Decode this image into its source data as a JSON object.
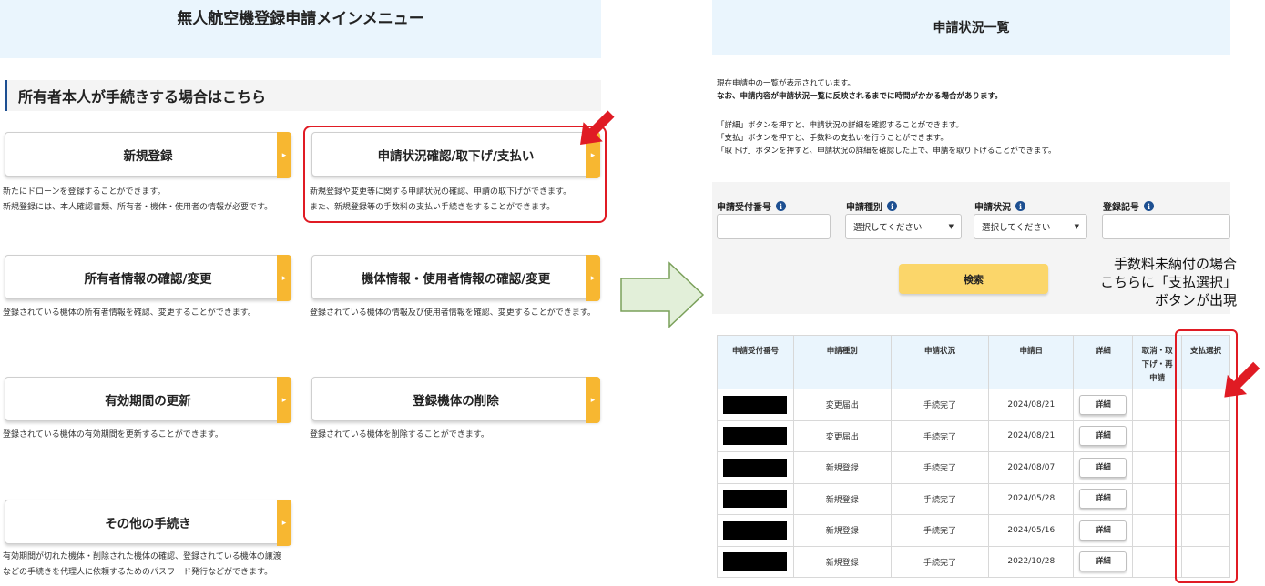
{
  "left": {
    "title": "無人航空機登録申請メインメニュー",
    "section_heading": "所有者本人が手続きする場合はこちら",
    "items": [
      {
        "label": "新規登録",
        "desc1": "新たにドローンを登録することができます。",
        "desc2": "新規登録には、本人確認書類、所有者・機体・使用者の情報が必要です。"
      },
      {
        "label": "申請状況確認/取下げ/支払い",
        "desc1": "新規登録や変更等に関する申請状況の確認、申請の取下げができます。",
        "desc2": "また、新規登録等の手数料の支払い手続きをすることができます。"
      },
      {
        "label": "所有者情報の確認/変更",
        "desc1": "登録されている機体の所有者情報を確認、変更することができます。"
      },
      {
        "label": "機体情報・使用者情報の確認/変更",
        "desc1": "登録されている機体の情報及び使用者情報を確認、変更することができます。"
      },
      {
        "label": "有効期間の更新",
        "desc1": "登録されている機体の有効期間を更新することができます。"
      },
      {
        "label": "登録機体の削除",
        "desc1": "登録されている機体を削除することができます。"
      },
      {
        "label": "その他の手続き",
        "desc1": "有効期間が切れた機体・削除された機体の確認、登録されている機体の譲渡",
        "desc2": "などの手続きを代理人に依頼するためのパスワード発行などができます。"
      }
    ],
    "arrow_symbol": "▸"
  },
  "right": {
    "title": "申請状況一覧",
    "info_lines": [
      "現在申請中の一覧が表示されています。",
      "なお、申請内容が申請状況一覧に反映されるまでに時間がかかる場合があります。",
      "「詳細」ボタンを押すと、申請状況の詳細を確認することができます。",
      "「支払」ボタンを押すと、手数料の支払いを行うことができます。",
      "「取下げ」ボタンを押すと、申請状況の詳細を確認した上で、申請を取り下げることができます。"
    ],
    "search": {
      "labels": [
        "申請受付番号",
        "申請種別",
        "申請状況",
        "登録記号"
      ],
      "select_placeholder": "選択してください",
      "info_glyph": "i",
      "search_button": "検索"
    },
    "note_lines": [
      "手数料未納付の場合",
      "こちらに「支払選択」",
      "ボタンが出現"
    ],
    "table": {
      "headers": [
        "申請受付番号",
        "申請種別",
        "申請状況",
        "申請日",
        "詳細",
        "取消・取\n下げ・再\n申請",
        "支払選択"
      ],
      "detail_label": "詳細",
      "rows": [
        {
          "type": "変更届出",
          "status": "手続完了",
          "date": "2024/08/21"
        },
        {
          "type": "変更届出",
          "status": "手続完了",
          "date": "2024/08/21"
        },
        {
          "type": "新規登録",
          "status": "手続完了",
          "date": "2024/08/07"
        },
        {
          "type": "新規登録",
          "status": "手続完了",
          "date": "2024/05/28"
        },
        {
          "type": "新規登録",
          "status": "手続完了",
          "date": "2024/05/16"
        },
        {
          "type": "新規登録",
          "status": "手続完了",
          "date": "2022/10/28"
        }
      ]
    }
  },
  "colors": {
    "title_bg": "#eaf5fd",
    "accent_yellow": "#f7b731",
    "highlight_red": "#e01b24",
    "arrow_green": "#e2efd9",
    "navy": "#1d4f91"
  }
}
